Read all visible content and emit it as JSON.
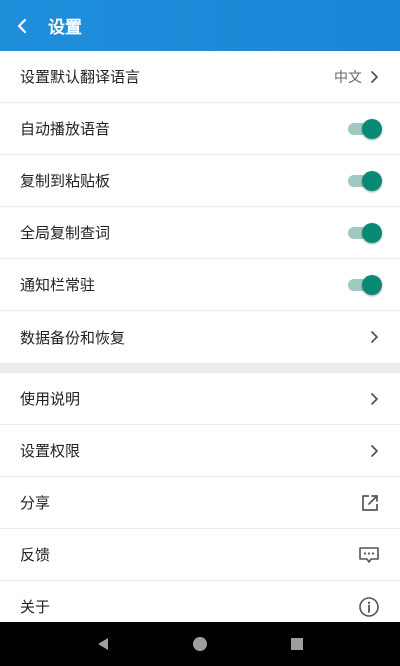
{
  "header": {
    "title": "设置",
    "back_icon": "back-arrow-icon"
  },
  "section1": [
    {
      "label": "设置默认翻译语言",
      "value": "中文",
      "control": "chevron"
    },
    {
      "label": "自动播放语音",
      "control": "toggle",
      "on": true
    },
    {
      "label": "复制到粘贴板",
      "control": "toggle",
      "on": true
    },
    {
      "label": "全局复制查词",
      "control": "toggle",
      "on": true
    },
    {
      "label": "通知栏常驻",
      "control": "toggle",
      "on": true
    },
    {
      "label": "数据备份和恢复",
      "control": "chevron"
    }
  ],
  "section2": [
    {
      "label": "使用说明",
      "control": "chevron"
    },
    {
      "label": "设置权限",
      "control": "chevron"
    },
    {
      "label": "分享",
      "control": "share-icon"
    },
    {
      "label": "反馈",
      "control": "feedback-icon"
    },
    {
      "label": "关于",
      "control": "info-icon"
    }
  ],
  "navbar": {
    "icons": [
      "back-triangle-icon",
      "home-circle-icon",
      "recents-square-icon"
    ]
  },
  "colors": {
    "appbar": "#1f8fdc",
    "toggle_on": "#0a8a75",
    "toggle_track": "#9dc9bf"
  }
}
